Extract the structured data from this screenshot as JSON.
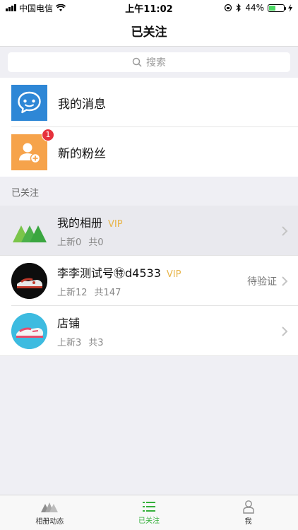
{
  "status_bar": {
    "carrier": "中国电信",
    "time": "上午11:02",
    "battery": "44%",
    "battery_level": 0.44
  },
  "nav": {
    "title": "已关注"
  },
  "search": {
    "placeholder": "搜索"
  },
  "shortcuts": [
    {
      "label": "我的消息",
      "icon": "chat-bubble-icon",
      "color": "#2e87d6"
    },
    {
      "label": "新的粉丝",
      "icon": "add-user-icon",
      "color": "#f6a34b",
      "badge": "1"
    }
  ],
  "section": {
    "title": "已关注"
  },
  "follows": [
    {
      "name": "我的相册",
      "vip": "VIP",
      "new_label": "上新0",
      "total_label": "共0",
      "status": ""
    },
    {
      "name": "李李测试号㊕d4533",
      "vip": "VIP",
      "new_label": "上新12",
      "total_label": "共147",
      "status": "待验证"
    },
    {
      "name": "店铺",
      "vip": "",
      "new_label": "上新3",
      "total_label": "共3",
      "status": ""
    }
  ],
  "tabs": [
    {
      "label": "相册动态",
      "icon": "mountains-icon",
      "active": false
    },
    {
      "label": "已关注",
      "icon": "list-icon",
      "active": true
    },
    {
      "label": "我",
      "icon": "person-icon",
      "active": false
    }
  ],
  "colors": {
    "accent": "#35b03b",
    "vip": "#e8b54a",
    "badge": "#e6323c"
  }
}
